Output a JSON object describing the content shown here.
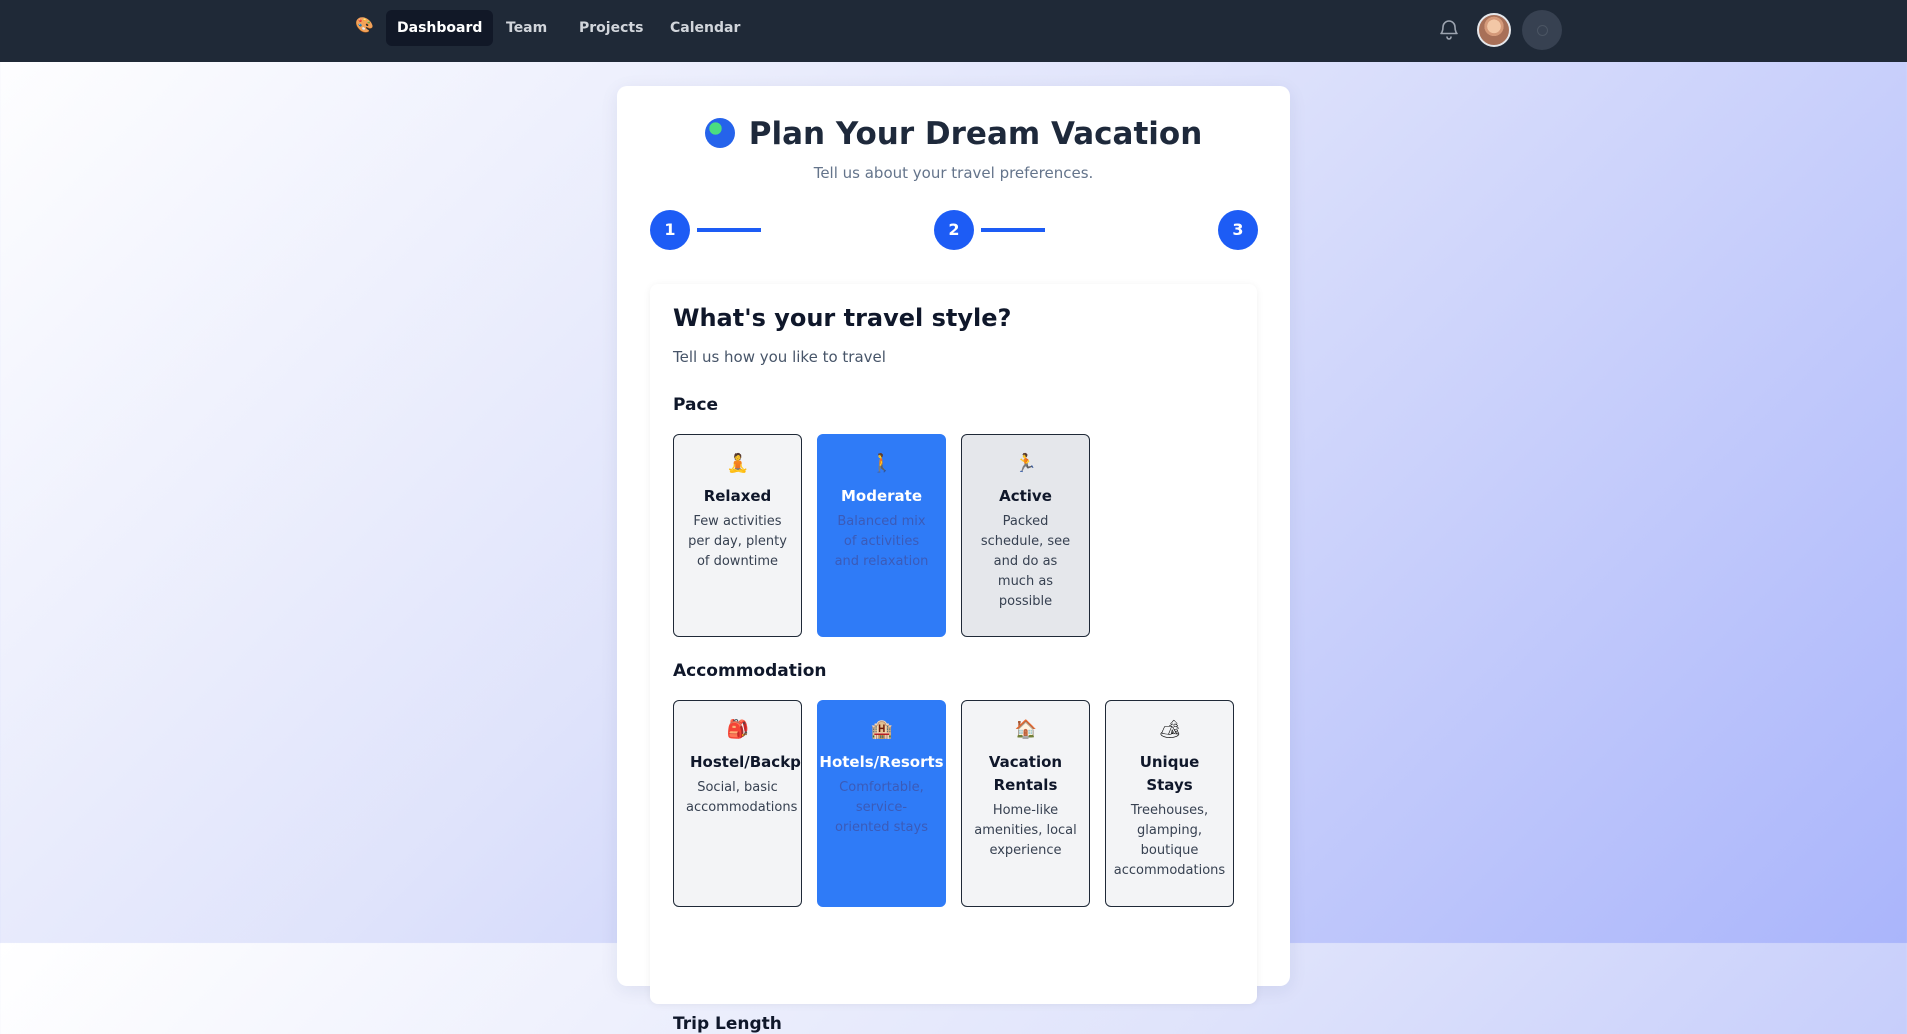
{
  "nav": {
    "logo_icon": "🎨",
    "links": [
      "Dashboard",
      "Team",
      "Projects",
      "Calendar"
    ],
    "active": "Dashboard",
    "bell_icon": "bell-icon",
    "avatar_icon": "user-avatar"
  },
  "header": {
    "title": "Plan Your Dream Vacation",
    "subtitle": "Tell us about your travel preferences."
  },
  "steps": [
    "1",
    "2",
    "3"
  ],
  "form": {
    "question": "What's your travel style?",
    "description": "Tell us how you like to travel",
    "pace": {
      "label": "Pace",
      "options": [
        {
          "icon": "🧘",
          "title": "Relaxed",
          "desc": "Few activities per day, plenty of downtime"
        },
        {
          "icon": "🚶",
          "title": "Moderate",
          "desc": "Balanced mix of activities and relaxation"
        },
        {
          "icon": "🏃",
          "title": "Active",
          "desc": "Packed schedule, see and do as much as possible"
        }
      ],
      "selected": "Moderate"
    },
    "accommodation": {
      "label": "Accommodation",
      "options": [
        {
          "icon": "🎒",
          "title": "Hostel/Backpacking",
          "desc": "Social, basic accommodations"
        },
        {
          "icon": "🏨",
          "title": "Hotels/Resorts",
          "desc": "Comfortable, service-oriented stays"
        },
        {
          "icon": "🏠",
          "title": "Vacation Rentals",
          "desc": "Home-like amenities, local experience"
        },
        {
          "icon": "🏕",
          "title": "Unique Stays",
          "desc": "Treehouses, glamping, boutique accommodations"
        }
      ],
      "selected": "Hotels/Resorts"
    },
    "trip_length_label": "Trip Length"
  },
  "colors": {
    "nav_bg": "#1f2937",
    "accent": "#1d5cf5",
    "selected_bg": "#2f7bf7"
  }
}
